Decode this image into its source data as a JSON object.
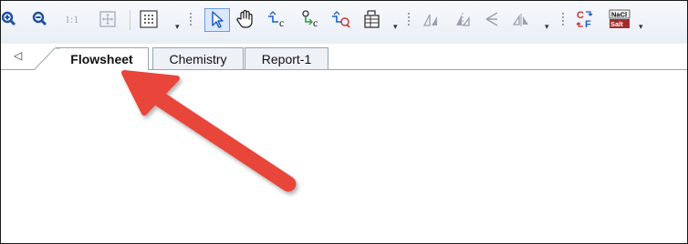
{
  "toolbar": {
    "zoom_reset_label": "1:1",
    "tools": [
      {
        "icon": "zoom-in-icon"
      },
      {
        "icon": "zoom-out-icon"
      },
      {
        "icon": "zoom-fit-icon"
      },
      {
        "icon": "grid-icon"
      },
      {
        "icon": "select-pointer-icon"
      },
      {
        "icon": "pan-hand-icon"
      },
      {
        "icon": "stream-icon"
      },
      {
        "icon": "connect-icon"
      },
      {
        "icon": "stream-label-icon"
      },
      {
        "icon": "table-icon"
      },
      {
        "icon": "align-icon"
      },
      {
        "icon": "flip-icon"
      },
      {
        "icon": "rotate-icon"
      },
      {
        "icon": "mirror-icon"
      },
      {
        "icon": "units-convert-icon"
      },
      {
        "icon": "nacl-salt-icon"
      }
    ],
    "units_badge": "C F",
    "salt_badge": "NaCl Salt"
  },
  "tabs": [
    {
      "label": "Flowsheet",
      "active": true
    },
    {
      "label": "Chemistry",
      "active": false
    },
    {
      "label": "Report-1",
      "active": false
    }
  ],
  "annotation": {
    "color": "#e8443a"
  },
  "colors": {
    "accent": "#1a5fd0",
    "arrow": "#e8443a",
    "tab_border": "#9aa4b3"
  }
}
